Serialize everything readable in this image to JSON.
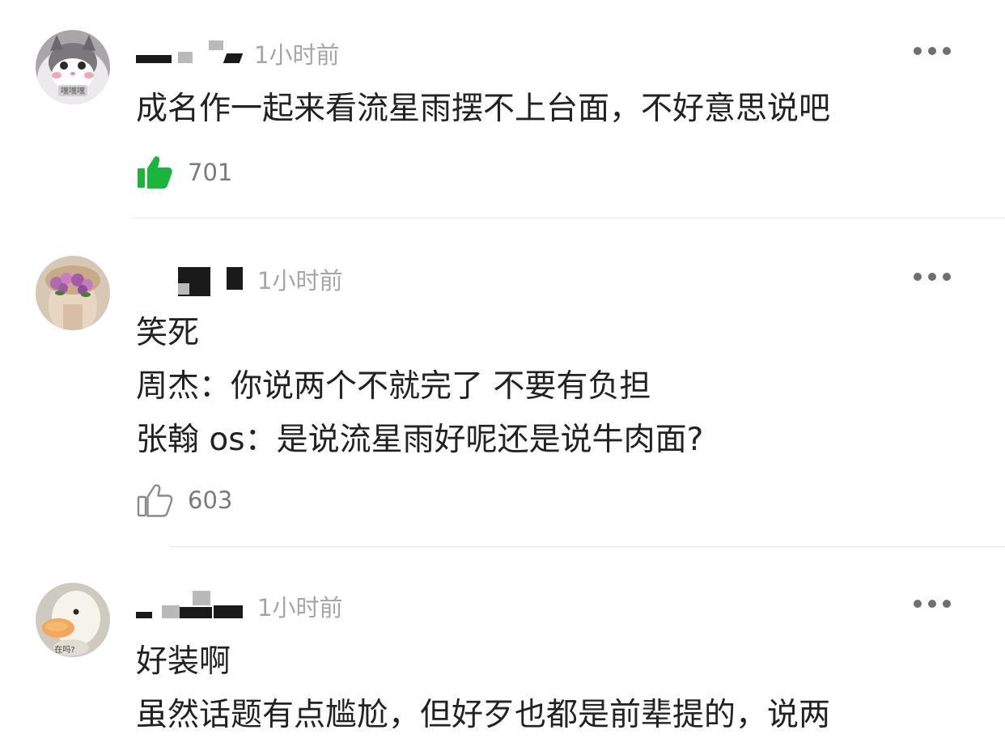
{
  "comments": [
    {
      "time": "1小时前",
      "lines": [
        "成名作一起来看流星雨摆不上台面，不好意思说吧"
      ],
      "likes": "701",
      "liked": true,
      "avatar_text": "嘿嘿嘿"
    },
    {
      "time": "1小时前",
      "lines": [
        "笑死",
        "周杰：你说两个不就完了 不要有负担",
        "张翰 os：是说流星雨好呢还是说牛肉面?"
      ],
      "likes": "603",
      "liked": false
    },
    {
      "time": "1小时前",
      "lines": [
        "好装啊",
        "虽然话题有点尴尬，但好歹也都是前辈提的，说两"
      ],
      "avatar_text": "在吗?"
    }
  ],
  "colors": {
    "liked_green": "#19b53d",
    "text": "#222222",
    "meta": "#a6a6a6"
  },
  "icons": {
    "like": "thumbs-up-icon",
    "more": "more-dots-icon"
  }
}
